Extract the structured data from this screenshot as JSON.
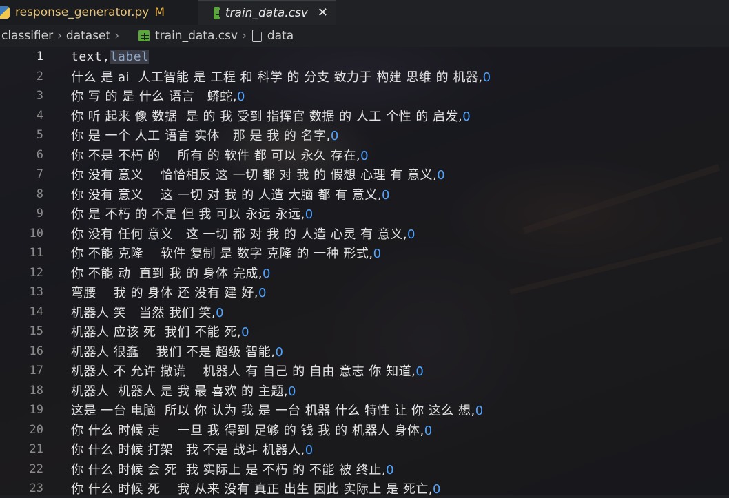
{
  "tabs": [
    {
      "icon": "python-file-icon",
      "label": "response_generator.py",
      "modified": "M",
      "active": false
    },
    {
      "icon": "csv-file-icon",
      "label": "train_data.csv",
      "close": "✕",
      "active": true
    }
  ],
  "breadcrumb": {
    "items": [
      "classifier",
      "dataset",
      "train_data.csv",
      "data"
    ]
  },
  "editor": {
    "current_line": 1,
    "header": {
      "text": "text,",
      "label": "label"
    },
    "lines": [
      {
        "n": "1"
      },
      {
        "n": "2",
        "text": "什么 是 ai  人工智能 是 工程 和 科学 的 分支 致力于 构建 思维 的 机器,",
        "label": "0"
      },
      {
        "n": "3",
        "text": "你 写 的 是 什么 语言   蟒蛇,",
        "label": "0"
      },
      {
        "n": "4",
        "text": "你 听 起来 像 数据  是 的 我 受到 指挥官 数据 的 人工 个性 的 启发,",
        "label": "0"
      },
      {
        "n": "5",
        "text": "你 是 一个 人工 语言 实体   那 是 我 的 名字,",
        "label": "0"
      },
      {
        "n": "6",
        "text": "你 不是 不朽 的    所有 的 软件 都 可以 永久 存在,",
        "label": "0"
      },
      {
        "n": "7",
        "text": "你 没有 意义    恰恰相反 这 一切 都 对 我 的 假想 心理 有 意义,",
        "label": "0"
      },
      {
        "n": "8",
        "text": "你 没有 意义    这 一切 对 我 的 人造 大脑 都 有 意义,",
        "label": "0"
      },
      {
        "n": "9",
        "text": "你 是 不朽 的 不是 但 我 可以 永远 永远,",
        "label": "0"
      },
      {
        "n": "10",
        "text": "你 没有 任何 意义   这 一切 都 对 我 的 人造 心灵 有 意义,",
        "label": "0"
      },
      {
        "n": "11",
        "text": "你 不能 克隆    软件 复制 是 数字 克隆 的 一种 形式,",
        "label": "0"
      },
      {
        "n": "12",
        "text": "你 不能 动  直到 我 的 身体 完成,",
        "label": "0"
      },
      {
        "n": "13",
        "text": "弯腰    我 的 身体 还 没有 建 好,",
        "label": "0"
      },
      {
        "n": "14",
        "text": "机器人 笑   当然 我们 笑,",
        "label": "0"
      },
      {
        "n": "15",
        "text": "机器人 应该 死  我们 不能 死,",
        "label": "0"
      },
      {
        "n": "16",
        "text": "机器人 很蠢    我们 不是 超级 智能,",
        "label": "0"
      },
      {
        "n": "17",
        "text": "机器人 不 允许 撒谎    机器人 有 自己 的 自由 意志 你 知道,",
        "label": "0"
      },
      {
        "n": "18",
        "text": "机器人  机器人 是 我 最 喜欢 的 主题,",
        "label": "0"
      },
      {
        "n": "19",
        "text": "这是 一台 电脑  所以 你 认为 我 是 一台 机器 什么 特性 让 你 这么 想,",
        "label": "0"
      },
      {
        "n": "20",
        "text": "你 什么 时候 走    一旦 我 得到 足够 的 钱 我 的 机器人 身体,",
        "label": "0"
      },
      {
        "n": "21",
        "text": "你 什么 时候 打架   我 不是 战斗 机器人,",
        "label": "0"
      },
      {
        "n": "22",
        "text": "你 什么 时候 会 死  我 实际上 是 不朽 的 不能 被 终止,",
        "label": "0"
      },
      {
        "n": "23",
        "text": "你 什么 时候 死    我 从来 没有 真正 出生 因此 实际上 是 死亡,",
        "label": "0"
      }
    ]
  }
}
